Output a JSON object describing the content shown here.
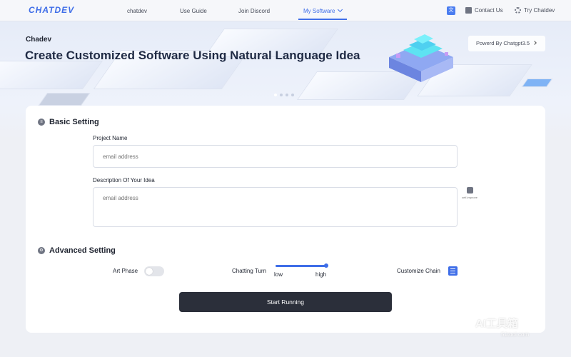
{
  "nav": {
    "logo": "CHATDEV",
    "links": [
      "chatdev",
      "Use Guide",
      "Join Discord"
    ],
    "active_link": "My Software",
    "translate_icon": "translate-icon",
    "contact": "Contact Us",
    "try": "Try Chatdev"
  },
  "hero": {
    "small_title": "Chadev",
    "title": "Create Customized Software Using Natural Language Idea",
    "powered": "Powerd By Chatgpt3.5"
  },
  "basic": {
    "heading": "Basic Setting",
    "project_label": "Project Name",
    "project_placeholder": "email address",
    "desc_label": "Description Of Your Idea",
    "desc_placeholder": "email address",
    "self_improve": "self-improve"
  },
  "advanced": {
    "heading": "Advanced Setting",
    "art_phase": "Art Phase",
    "art_phase_on": false,
    "chatting_turn": "Chatting Turn",
    "low": "low",
    "high": "high",
    "chatting_turn_level": 1.0,
    "customize_chain": "Customize Chain"
  },
  "start_button": "Start Running",
  "watermark": {
    "main": "AI工具箱",
    "sub": "51tool.com"
  },
  "colors": {
    "accent": "#3f6ee8",
    "button": "#2b2f3a"
  }
}
